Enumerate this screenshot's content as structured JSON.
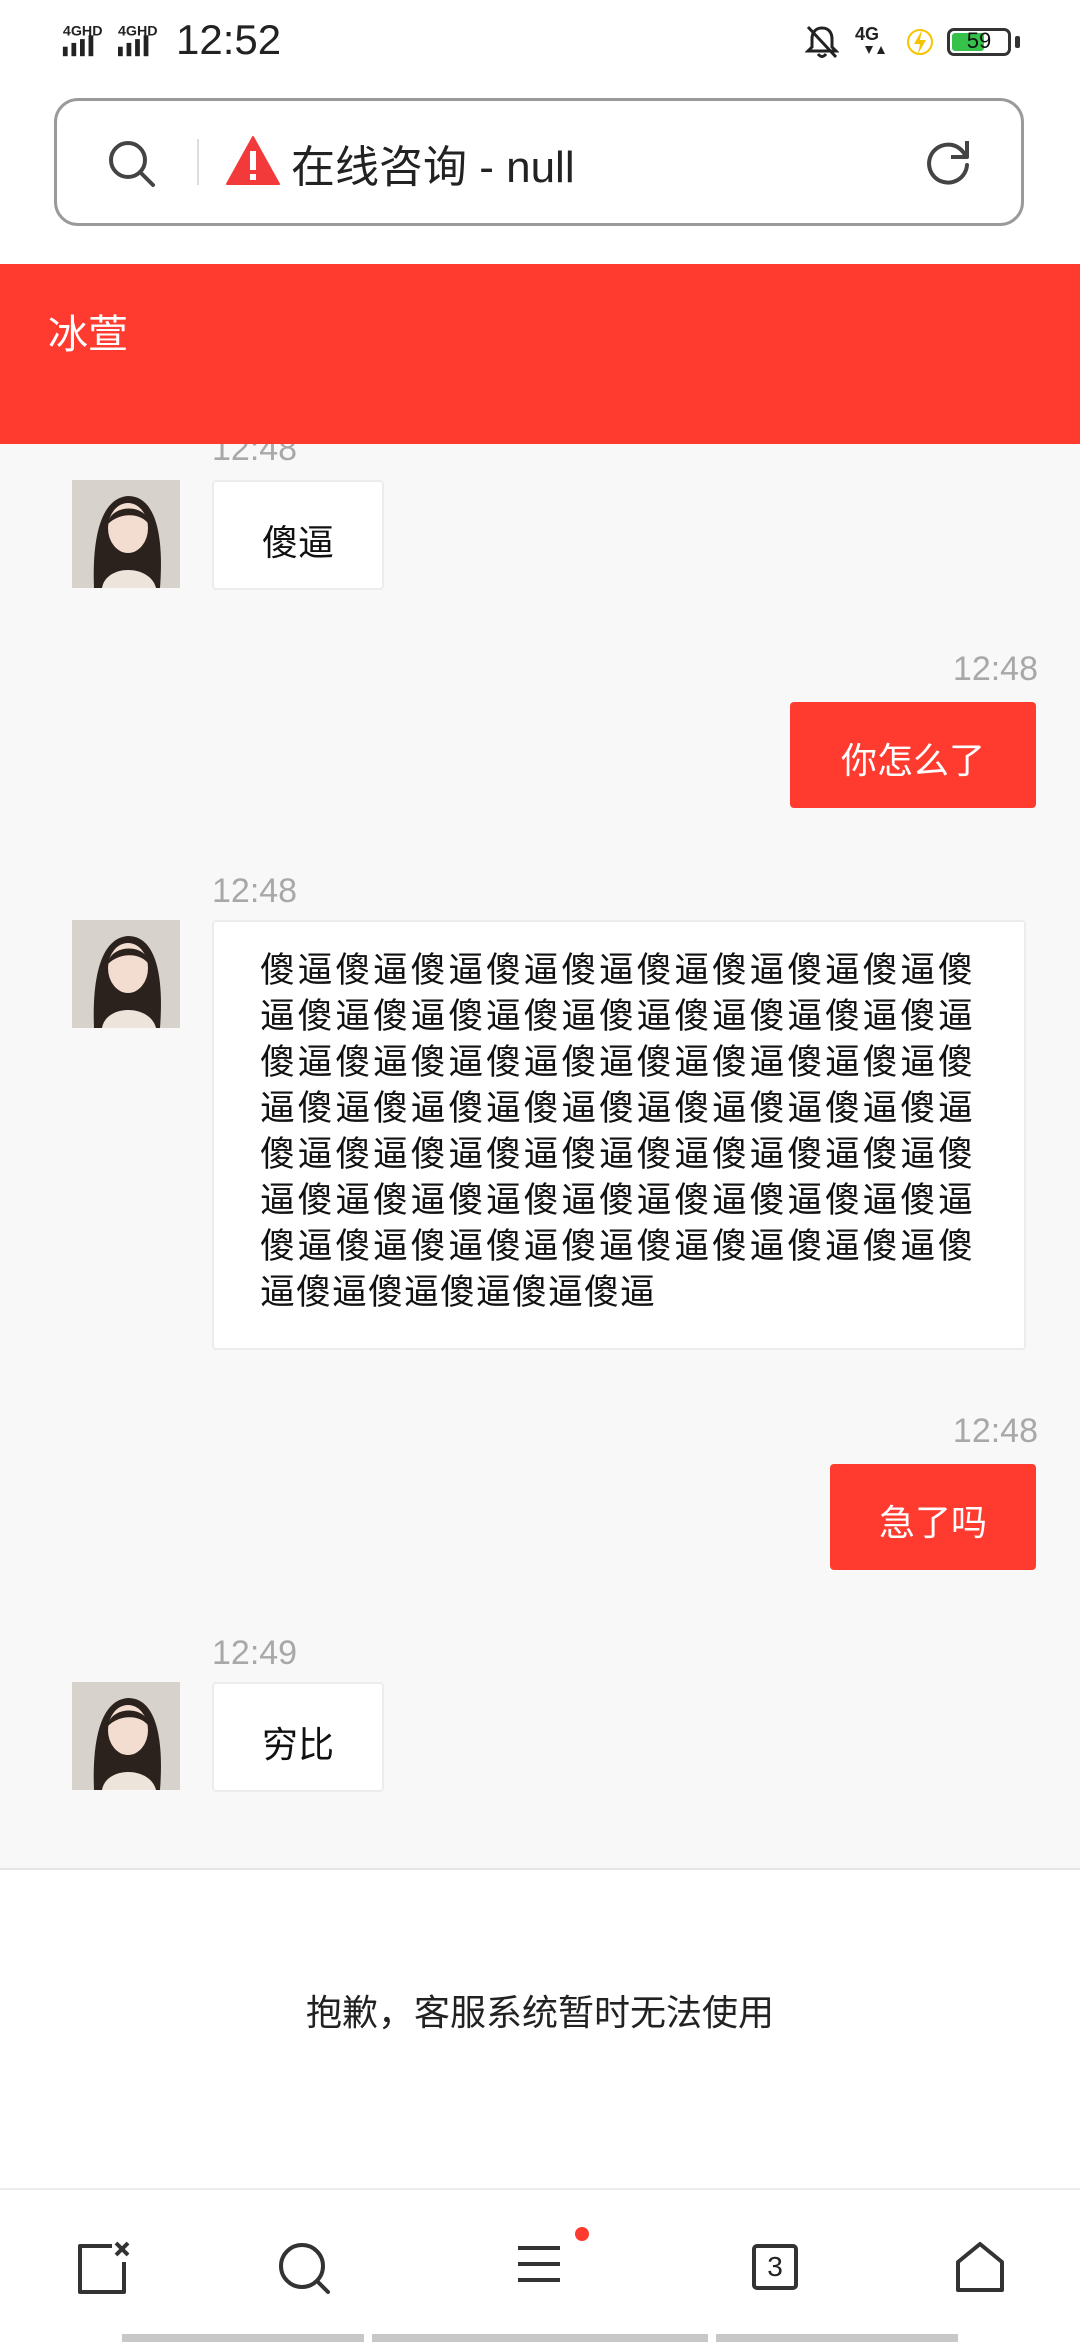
{
  "status_bar": {
    "network_1": "4GHD",
    "network_2": "4GHD",
    "time": "12:52",
    "mobile_data": "4G",
    "battery_level": "59",
    "battery_fraction": 0.59,
    "icons": [
      "signal-icon",
      "bell-off-icon",
      "mobile-data-icon",
      "charging-icon",
      "battery-icon"
    ]
  },
  "url_bar": {
    "title": "在线咨询 - null",
    "icons": [
      "search-icon",
      "warning-icon",
      "reload-icon"
    ]
  },
  "header": {
    "title": "冰萱"
  },
  "messages": [
    {
      "direction": "in",
      "time": "12:48",
      "text": "傻逼"
    },
    {
      "direction": "out",
      "time": "12:48",
      "text": "你怎么了"
    },
    {
      "direction": "in",
      "time": "12:48",
      "text": "傻逼傻逼傻逼傻逼傻逼傻逼傻逼傻逼傻逼傻逼傻逼傻逼傻逼傻逼傻逼傻逼傻逼傻逼傻逼傻逼傻逼傻逼傻逼傻逼傻逼傻逼傻逼傻逼傻逼傻逼傻逼傻逼傻逼傻逼傻逼傻逼傻逼傻逼傻逼傻逼傻逼傻逼傻逼傻逼傻逼傻逼傻逼傻逼傻逼傻逼傻逼傻逼傻逼傻逼傻逼傻逼傻逼傻逼傻逼傻逼傻逼傻逼傻逼傻逼傻逼傻逼傻逼傻逼傻逼傻逼傻逼傻逼"
    },
    {
      "direction": "out",
      "time": "12:48",
      "text": "急了吗"
    },
    {
      "direction": "in",
      "time": "12:49",
      "text": "穷比"
    }
  ],
  "notice": {
    "text": "抱歉，客服系统暂时无法使用"
  },
  "bottom_nav": {
    "tab_count": "3",
    "icons": [
      "close-page-icon",
      "search-icon",
      "menu-icon",
      "tabs-icon",
      "home-icon"
    ]
  },
  "colors": {
    "accent": "#ff3b30",
    "background": "#f8f8f8",
    "bubble_in": "#ffffff",
    "timestamp": "#a8a8a8",
    "battery": "#36c24a"
  }
}
